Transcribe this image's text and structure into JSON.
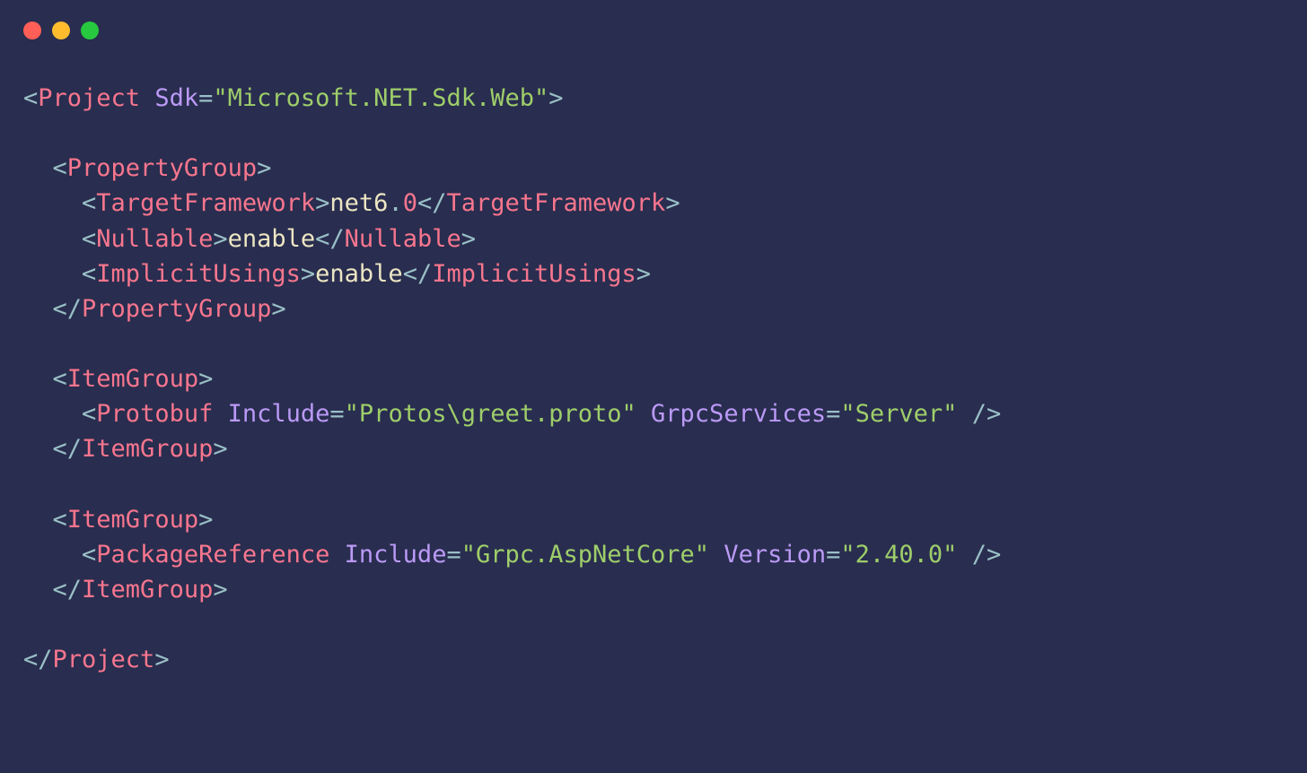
{
  "theme": {
    "bg": "#292d4f",
    "red": "#ff5f56",
    "yellow": "#ffbd2e",
    "green": "#27c93f",
    "punc": "#9ac0c7",
    "tag": "#f7768e",
    "attr": "#bb9af7",
    "string": "#9ece6a",
    "text": "#ece6c3"
  },
  "code": {
    "lines": [
      [
        {
          "t": "<",
          "c": "punc"
        },
        {
          "t": "Project",
          "c": "tag"
        },
        {
          "t": " "
        },
        {
          "t": "Sdk",
          "c": "attr"
        },
        {
          "t": "=",
          "c": "punc"
        },
        {
          "t": "\"Microsoft.NET.Sdk.Web\"",
          "c": "string"
        },
        {
          "t": ">",
          "c": "punc"
        }
      ],
      [],
      [
        {
          "t": "  "
        },
        {
          "t": "<",
          "c": "punc"
        },
        {
          "t": "PropertyGroup",
          "c": "tag"
        },
        {
          "t": ">",
          "c": "punc"
        }
      ],
      [
        {
          "t": "    "
        },
        {
          "t": "<",
          "c": "punc"
        },
        {
          "t": "TargetFramework",
          "c": "tag"
        },
        {
          "t": ">",
          "c": "punc"
        },
        {
          "t": "net6",
          "c": "net"
        },
        {
          "t": ".",
          "c": "punc"
        },
        {
          "t": "0",
          "c": "num"
        },
        {
          "t": "</",
          "c": "punc"
        },
        {
          "t": "TargetFramework",
          "c": "tag"
        },
        {
          "t": ">",
          "c": "punc"
        }
      ],
      [
        {
          "t": "    "
        },
        {
          "t": "<",
          "c": "punc"
        },
        {
          "t": "Nullable",
          "c": "tag"
        },
        {
          "t": ">",
          "c": "punc"
        },
        {
          "t": "enable",
          "c": "enable"
        },
        {
          "t": "</",
          "c": "punc"
        },
        {
          "t": "Nullable",
          "c": "tag"
        },
        {
          "t": ">",
          "c": "punc"
        }
      ],
      [
        {
          "t": "    "
        },
        {
          "t": "<",
          "c": "punc"
        },
        {
          "t": "ImplicitUsings",
          "c": "tag"
        },
        {
          "t": ">",
          "c": "punc"
        },
        {
          "t": "enable",
          "c": "enable"
        },
        {
          "t": "</",
          "c": "punc"
        },
        {
          "t": "ImplicitUsings",
          "c": "tag"
        },
        {
          "t": ">",
          "c": "punc"
        }
      ],
      [
        {
          "t": "  "
        },
        {
          "t": "</",
          "c": "punc"
        },
        {
          "t": "PropertyGroup",
          "c": "tag"
        },
        {
          "t": ">",
          "c": "punc"
        }
      ],
      [],
      [
        {
          "t": "  "
        },
        {
          "t": "<",
          "c": "punc"
        },
        {
          "t": "ItemGroup",
          "c": "tag"
        },
        {
          "t": ">",
          "c": "punc"
        }
      ],
      [
        {
          "t": "    "
        },
        {
          "t": "<",
          "c": "punc"
        },
        {
          "t": "Protobuf",
          "c": "tag"
        },
        {
          "t": " "
        },
        {
          "t": "Include",
          "c": "attr"
        },
        {
          "t": "=",
          "c": "punc"
        },
        {
          "t": "\"Protos\\greet.proto\"",
          "c": "string"
        },
        {
          "t": " "
        },
        {
          "t": "GrpcServices",
          "c": "attr"
        },
        {
          "t": "=",
          "c": "punc"
        },
        {
          "t": "\"Server\"",
          "c": "string"
        },
        {
          "t": " /",
          "c": "punc"
        },
        {
          "t": ">",
          "c": "punc"
        }
      ],
      [
        {
          "t": "  "
        },
        {
          "t": "</",
          "c": "punc"
        },
        {
          "t": "ItemGroup",
          "c": "tag"
        },
        {
          "t": ">",
          "c": "punc"
        }
      ],
      [],
      [
        {
          "t": "  "
        },
        {
          "t": "<",
          "c": "punc"
        },
        {
          "t": "ItemGroup",
          "c": "tag"
        },
        {
          "t": ">",
          "c": "punc"
        }
      ],
      [
        {
          "t": "    "
        },
        {
          "t": "<",
          "c": "punc"
        },
        {
          "t": "PackageReference",
          "c": "tag"
        },
        {
          "t": " "
        },
        {
          "t": "Include",
          "c": "attr"
        },
        {
          "t": "=",
          "c": "punc"
        },
        {
          "t": "\"Grpc.AspNetCore\"",
          "c": "string"
        },
        {
          "t": " "
        },
        {
          "t": "Version",
          "c": "attr"
        },
        {
          "t": "=",
          "c": "punc"
        },
        {
          "t": "\"2.40.0\"",
          "c": "string"
        },
        {
          "t": " /",
          "c": "punc"
        },
        {
          "t": ">",
          "c": "punc"
        }
      ],
      [
        {
          "t": "  "
        },
        {
          "t": "</",
          "c": "punc"
        },
        {
          "t": "ItemGroup",
          "c": "tag"
        },
        {
          "t": ">",
          "c": "punc"
        }
      ],
      [],
      [
        {
          "t": "</",
          "c": "punc"
        },
        {
          "t": "Project",
          "c": "tag"
        },
        {
          "t": ">",
          "c": "punc"
        }
      ]
    ]
  }
}
